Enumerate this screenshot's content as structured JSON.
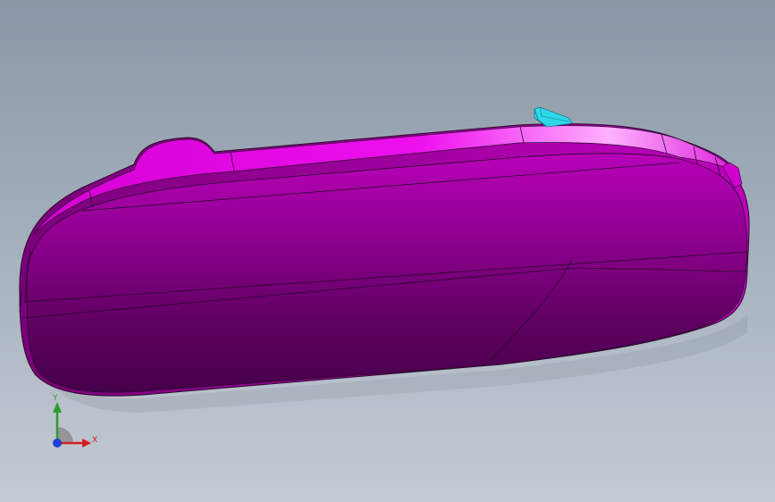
{
  "viewport": {
    "background_top": "#8a97a6",
    "background_bottom": "#c4cbd4"
  },
  "model": {
    "body_color": "#c800c8",
    "feature_color": "#2fd8e8",
    "edge_color": "#2a0a2a"
  },
  "triad": {
    "x_label": "X",
    "y_label": "Y",
    "x_color": "#d22020",
    "y_color": "#2f9a35",
    "z_color": "#2040d0"
  }
}
